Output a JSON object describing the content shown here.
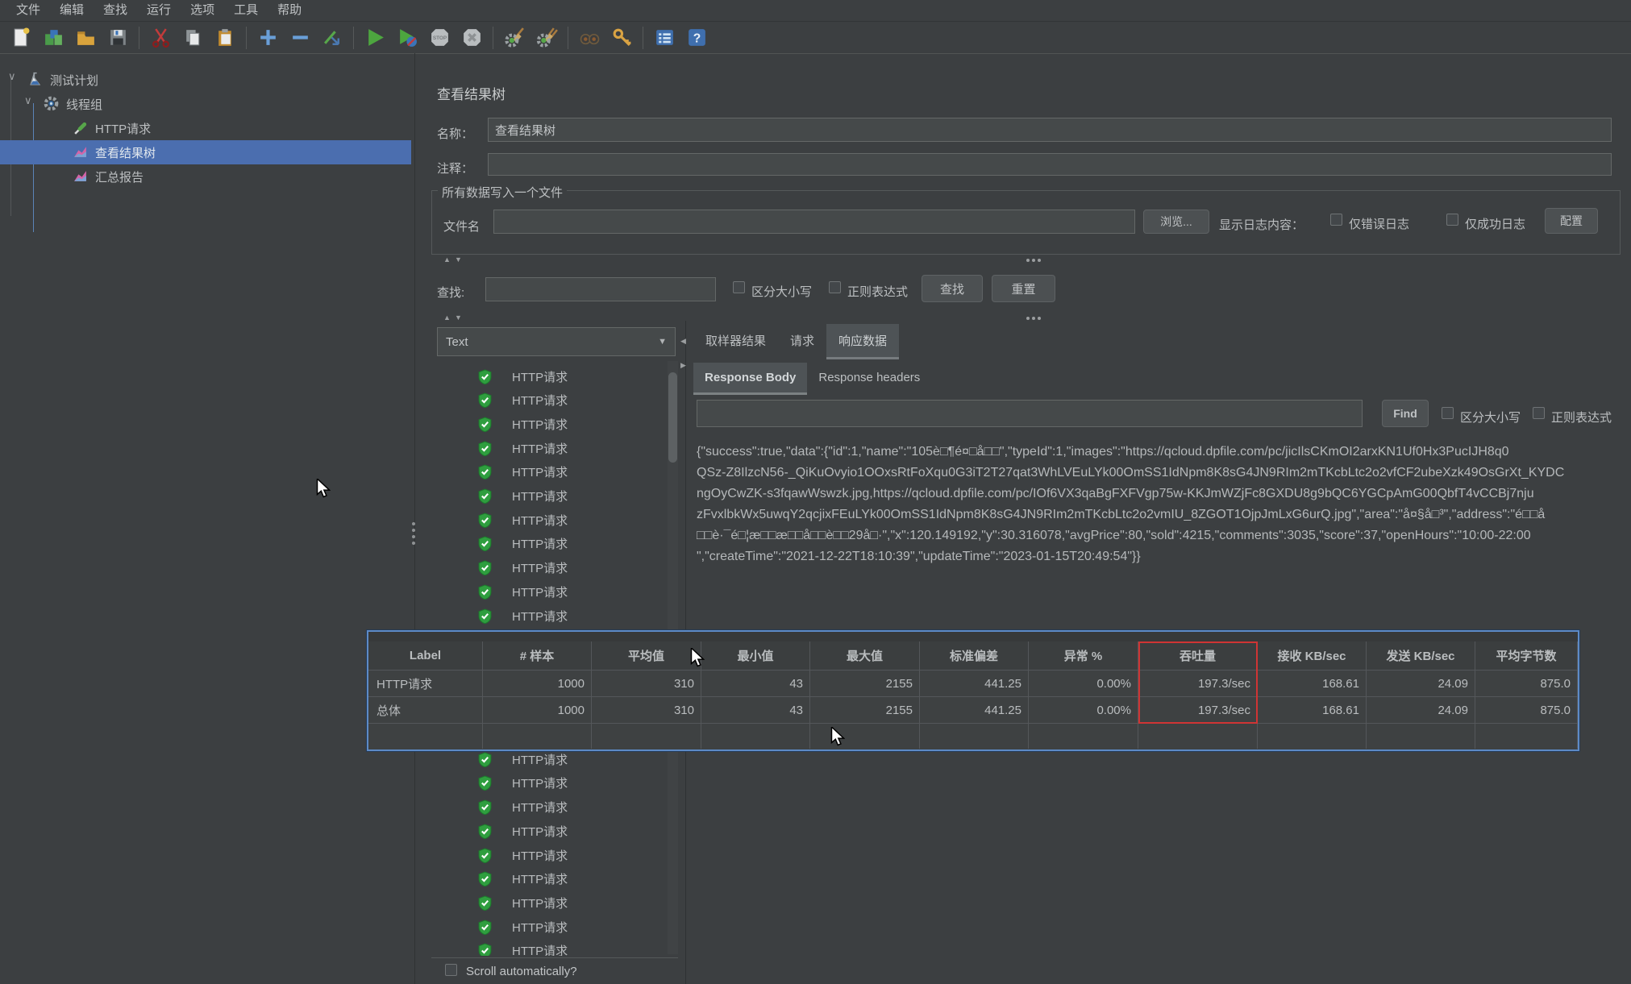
{
  "menu_items": [
    "文件",
    "编辑",
    "查找",
    "运行",
    "选项",
    "工具",
    "帮助"
  ],
  "toolbar_icons": [
    "new-file",
    "open-template",
    "open-file",
    "save",
    "cut",
    "copy",
    "paste",
    "add",
    "remove",
    "toggle",
    "start",
    "start-no-timers",
    "stop",
    "shutdown",
    "clear",
    "clear-all",
    "search",
    "search-reset",
    "function-helper",
    "help"
  ],
  "tree": {
    "items": [
      {
        "label": "测试计划",
        "icon": "flask",
        "indent": 10,
        "chevron": true,
        "selected": false
      },
      {
        "label": "线程组",
        "icon": "gear",
        "indent": 30,
        "chevron": true,
        "selected": false
      },
      {
        "label": "HTTP请求",
        "icon": "pipette",
        "indent": 90,
        "chevron": false,
        "selected": false
      },
      {
        "label": "查看结果树",
        "icon": "chart",
        "indent": 90,
        "chevron": false,
        "selected": true
      },
      {
        "label": "汇总报告",
        "icon": "chart",
        "indent": 90,
        "chevron": false,
        "selected": false
      }
    ]
  },
  "editor": {
    "title": "查看结果树",
    "name_label": "名称：",
    "name_value": "查看结果树",
    "comment_label": "注释：",
    "comment_value": "",
    "file_group_title": "所有数据写入一个文件",
    "filename_label": "文件名",
    "filename_value": "",
    "browse_button": "浏览...",
    "log_display_label": "显示日志内容：",
    "errors_only_label": "仅错误日志",
    "success_only_label": "仅成功日志",
    "config_button": "配置"
  },
  "search_bar": {
    "label": "查找:",
    "value": "",
    "case_label": "区分大小写",
    "regex_label": "正则表达式",
    "find_button": "查找",
    "reset_button": "重置"
  },
  "results_tree": {
    "renderer_value": "Text",
    "sample_label": "HTTP请求",
    "visible_sample_count": 25,
    "scroll_label": "Scroll automatically?",
    "tabs": [
      "取样器结果",
      "请求",
      "响应数据"
    ],
    "active_tab_index": 2,
    "subtabs": [
      "Response Body",
      "Response headers"
    ],
    "active_subtab_index": 0,
    "find_value": "",
    "find_button": "Find",
    "case_label": "区分大小写",
    "regex_label": "正则表达式",
    "response_lines": [
      "{\"success\":true,\"data\":{\"id\":1,\"name\":\"105è□¶é¤□å□□\",\"typeId\":1,\"images\":\"https://qcloud.dpfile.com/pc/jicIlsCKmOI2arxKN1Uf0Hx3PucIJH8q0",
      "QSz-Z8IlzcN56-_QiKuOvyio1OOxsRtFoXqu0G3iT2T27qat3WhLVEuLYk00OmSS1IdNpm8K8sG4JN9RIm2mTKcbLtc2o2vfCF2ubeXzk49OsGrXt_KYDC",
      "ngOyCwZK-s3fqawWswzk.jpg,https://qcloud.dpfile.com/pc/IOf6VX3qaBgFXFVgp75w-KKJmWZjFc8GXDU8g9bQC6YGCpAmG00QbfT4vCCBj7nju",
      "zFvxlbkWx5uwqY2qcjixFEuLYk00OmSS1IdNpm8K8sG4JN9RIm2mTKcbLtc2o2vmIU_8ZGOT1OjpJmLxG6urQ.jpg\",\"area\":\"å¤§å□³\",\"address\":\"é□□å",
      "□□è·¯é□¦æ□□æ□□å□□è□□29å□·\",\"x\":120.149192,\"y\":30.316078,\"avgPrice\":80,\"sold\":4215,\"comments\":3035,\"score\":37,\"openHours\":\"10:00-22:00",
      "\",\"createTime\":\"2021-12-22T18:10:39\",\"updateTime\":\"2023-01-15T20:49:54\"}}"
    ]
  },
  "summary_table": {
    "columns": [
      "Label",
      "# 样本",
      "平均值",
      "最小值",
      "最大值",
      "标准偏差",
      "异常 %",
      "吞吐量",
      "接收 KB/sec",
      "发送 KB/sec",
      "平均字节数"
    ],
    "highlight_column_index": 7,
    "rows": [
      [
        "HTTP请求",
        "1000",
        "310",
        "43",
        "2155",
        "441.25",
        "0.00%",
        "197.3/sec",
        "168.61",
        "24.09",
        "875.0"
      ],
      [
        "总体",
        "1000",
        "310",
        "43",
        "2155",
        "441.25",
        "0.00%",
        "197.3/sec",
        "168.61",
        "24.09",
        "875.0"
      ]
    ]
  },
  "colors": {
    "selection": "#4b6eaf",
    "table_focus_border": "#5d8ac6",
    "highlight_box": "#cf3434",
    "shield_green": "#2f9e3f"
  }
}
